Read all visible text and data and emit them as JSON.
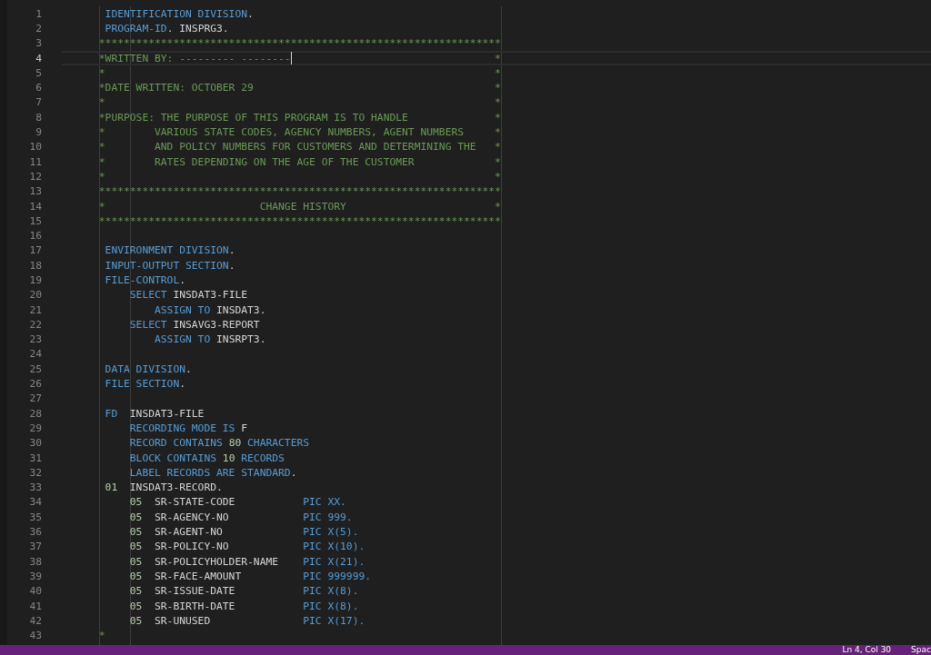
{
  "lines": [
    {
      "number": "1",
      "current": false,
      "tokens": [
        {
          "kind": "keyword",
          "text": " IDENTIFICATION DIVISION"
        },
        {
          "kind": "plain",
          "text": "."
        }
      ]
    },
    {
      "number": "2",
      "current": false,
      "tokens": [
        {
          "kind": "keyword",
          "text": " PROGRAM-ID"
        },
        {
          "kind": "plain",
          "text": ". INSPRG3."
        }
      ]
    },
    {
      "number": "3",
      "current": false,
      "tokens": [
        {
          "kind": "comment",
          "text": "*****************************************************************"
        }
      ]
    },
    {
      "number": "4",
      "current": true,
      "tokens": [
        {
          "kind": "comment",
          "text": "*WRITTEN BY: --------- --------"
        },
        {
          "kind": "edge",
          "text": "*"
        }
      ]
    },
    {
      "number": "5",
      "current": false,
      "tokens": [
        {
          "kind": "comment",
          "text": "*"
        },
        {
          "kind": "edge",
          "text": "*"
        }
      ]
    },
    {
      "number": "6",
      "current": false,
      "tokens": [
        {
          "kind": "comment",
          "text": "*DATE WRITTEN: OCTOBER 29"
        },
        {
          "kind": "edge",
          "text": "*"
        }
      ]
    },
    {
      "number": "7",
      "current": false,
      "tokens": [
        {
          "kind": "comment",
          "text": "*"
        },
        {
          "kind": "edge",
          "text": "*"
        }
      ]
    },
    {
      "number": "8",
      "current": false,
      "tokens": [
        {
          "kind": "comment",
          "text": "*PURPOSE: THE PURPOSE OF THIS PROGRAM IS TO HANDLE"
        },
        {
          "kind": "edge",
          "text": "*"
        }
      ]
    },
    {
      "number": "9",
      "current": false,
      "tokens": [
        {
          "kind": "comment",
          "text": "*        VARIOUS STATE CODES, AGENCY NUMBERS, AGENT NUMBERS"
        },
        {
          "kind": "edge",
          "text": "*"
        }
      ]
    },
    {
      "number": "10",
      "current": false,
      "tokens": [
        {
          "kind": "comment",
          "text": "*        AND POLICY NUMBERS FOR CUSTOMERS AND DETERMINING THE"
        },
        {
          "kind": "edge",
          "text": "*"
        }
      ]
    },
    {
      "number": "11",
      "current": false,
      "tokens": [
        {
          "kind": "comment",
          "text": "*        RATES DEPENDING ON THE AGE OF THE CUSTOMER"
        },
        {
          "kind": "edge",
          "text": "*"
        }
      ]
    },
    {
      "number": "12",
      "current": false,
      "tokens": [
        {
          "kind": "comment",
          "text": "*"
        },
        {
          "kind": "edge",
          "text": "*"
        }
      ]
    },
    {
      "number": "13",
      "current": false,
      "tokens": [
        {
          "kind": "comment",
          "text": "*****************************************************************"
        }
      ]
    },
    {
      "number": "14",
      "current": false,
      "tokens": [
        {
          "kind": "comment",
          "text": "*                         CHANGE HISTORY"
        },
        {
          "kind": "edge",
          "text": "*"
        }
      ]
    },
    {
      "number": "15",
      "current": false,
      "tokens": [
        {
          "kind": "comment",
          "text": "*****************************************************************"
        }
      ]
    },
    {
      "number": "16",
      "current": false
    },
    {
      "number": "17",
      "current": false,
      "tokens": [
        {
          "kind": "keyword",
          "text": " ENVIRONMENT DIVISION"
        },
        {
          "kind": "plain",
          "text": "."
        }
      ]
    },
    {
      "number": "18",
      "current": false,
      "tokens": [
        {
          "kind": "keyword",
          "text": " INPUT-OUTPUT SECTION"
        },
        {
          "kind": "plain",
          "text": "."
        }
      ]
    },
    {
      "number": "19",
      "current": false,
      "tokens": [
        {
          "kind": "keyword",
          "text": " FILE-CONTROL"
        },
        {
          "kind": "plain",
          "text": "."
        }
      ]
    },
    {
      "number": "20",
      "current": false,
      "tokens": [
        {
          "kind": "keyword",
          "text": "     SELECT"
        },
        {
          "kind": "plain",
          "text": " INSDAT3-FILE"
        }
      ]
    },
    {
      "number": "21",
      "current": false,
      "tokens": [
        {
          "kind": "keyword",
          "text": "         ASSIGN TO"
        },
        {
          "kind": "plain",
          "text": " INSDAT3."
        }
      ]
    },
    {
      "number": "22",
      "current": false,
      "tokens": [
        {
          "kind": "keyword",
          "text": "     SELECT"
        },
        {
          "kind": "plain",
          "text": " INSAVG3-REPORT"
        }
      ]
    },
    {
      "number": "23",
      "current": false,
      "tokens": [
        {
          "kind": "keyword",
          "text": "         ASSIGN TO"
        },
        {
          "kind": "plain",
          "text": " INSRPT3."
        }
      ]
    },
    {
      "number": "24",
      "current": false
    },
    {
      "number": "25",
      "current": false,
      "tokens": [
        {
          "kind": "keyword",
          "text": " DATA DIVISION"
        },
        {
          "kind": "plain",
          "text": "."
        }
      ]
    },
    {
      "number": "26",
      "current": false,
      "tokens": [
        {
          "kind": "keyword",
          "text": " FILE SECTION"
        },
        {
          "kind": "plain",
          "text": "."
        }
      ]
    },
    {
      "number": "27",
      "current": false
    },
    {
      "number": "28",
      "current": false,
      "tokens": [
        {
          "kind": "keyword",
          "text": " FD"
        },
        {
          "kind": "plain",
          "text": "  INSDAT3-FILE"
        }
      ]
    },
    {
      "number": "29",
      "current": false,
      "tokens": [
        {
          "kind": "keyword",
          "text": "     RECORDING MODE IS"
        },
        {
          "kind": "plain",
          "text": " F"
        }
      ]
    },
    {
      "number": "30",
      "current": false,
      "tokens": [
        {
          "kind": "keyword",
          "text": "     RECORD CONTAINS"
        },
        {
          "kind": "number",
          "text": " 80"
        },
        {
          "kind": "keyword",
          "text": " CHARACTERS"
        }
      ]
    },
    {
      "number": "31",
      "current": false,
      "tokens": [
        {
          "kind": "keyword",
          "text": "     BLOCK CONTAINS"
        },
        {
          "kind": "number",
          "text": " 10"
        },
        {
          "kind": "keyword",
          "text": " RECORDS"
        }
      ]
    },
    {
      "number": "32",
      "current": false,
      "tokens": [
        {
          "kind": "keyword",
          "text": "     LABEL RECORDS ARE STANDARD"
        },
        {
          "kind": "plain",
          "text": "."
        }
      ]
    },
    {
      "number": "33",
      "current": false,
      "tokens": [
        {
          "kind": "number",
          "text": " 01"
        },
        {
          "kind": "plain",
          "text": "  INSDAT3-RECORD."
        }
      ]
    },
    {
      "number": "34",
      "current": false,
      "tokens": [
        {
          "kind": "number",
          "text": "     05"
        },
        {
          "kind": "plain",
          "text": "  SR-STATE-CODE           "
        },
        {
          "kind": "keyword",
          "text": "PIC XX."
        }
      ]
    },
    {
      "number": "35",
      "current": false,
      "tokens": [
        {
          "kind": "number",
          "text": "     05"
        },
        {
          "kind": "plain",
          "text": "  SR-AGENCY-NO            "
        },
        {
          "kind": "keyword",
          "text": "PIC 999."
        }
      ]
    },
    {
      "number": "36",
      "current": false,
      "tokens": [
        {
          "kind": "number",
          "text": "     05"
        },
        {
          "kind": "plain",
          "text": "  SR-AGENT-NO             "
        },
        {
          "kind": "keyword",
          "text": "PIC X(5)."
        }
      ]
    },
    {
      "number": "37",
      "current": false,
      "tokens": [
        {
          "kind": "number",
          "text": "     05"
        },
        {
          "kind": "plain",
          "text": "  SR-POLICY-NO            "
        },
        {
          "kind": "keyword",
          "text": "PIC X(10)."
        }
      ]
    },
    {
      "number": "38",
      "current": false,
      "tokens": [
        {
          "kind": "number",
          "text": "     05"
        },
        {
          "kind": "plain",
          "text": "  SR-POLICYHOLDER-NAME    "
        },
        {
          "kind": "keyword",
          "text": "PIC X(21)."
        }
      ]
    },
    {
      "number": "39",
      "current": false,
      "tokens": [
        {
          "kind": "number",
          "text": "     05"
        },
        {
          "kind": "plain",
          "text": "  SR-FACE-AMOUNT          "
        },
        {
          "kind": "keyword",
          "text": "PIC 999999."
        }
      ]
    },
    {
      "number": "40",
      "current": false,
      "tokens": [
        {
          "kind": "number",
          "text": "     05"
        },
        {
          "kind": "plain",
          "text": "  SR-ISSUE-DATE           "
        },
        {
          "kind": "keyword",
          "text": "PIC X(8)."
        }
      ]
    },
    {
      "number": "41",
      "current": false,
      "tokens": [
        {
          "kind": "number",
          "text": "     05"
        },
        {
          "kind": "plain",
          "text": "  SR-BIRTH-DATE           "
        },
        {
          "kind": "keyword",
          "text": "PIC X(8)."
        }
      ]
    },
    {
      "number": "42",
      "current": false,
      "tokens": [
        {
          "kind": "number",
          "text": "     05"
        },
        {
          "kind": "plain",
          "text": "  SR-UNUSED               "
        },
        {
          "kind": "keyword",
          "text": "PIC X(17)."
        }
      ]
    },
    {
      "number": "43",
      "current": false,
      "tokens": [
        {
          "kind": "comment",
          "text": "*"
        }
      ]
    }
  ],
  "status_bar": {
    "items": [
      "Ln 4, Col 30",
      "Spac"
    ]
  }
}
